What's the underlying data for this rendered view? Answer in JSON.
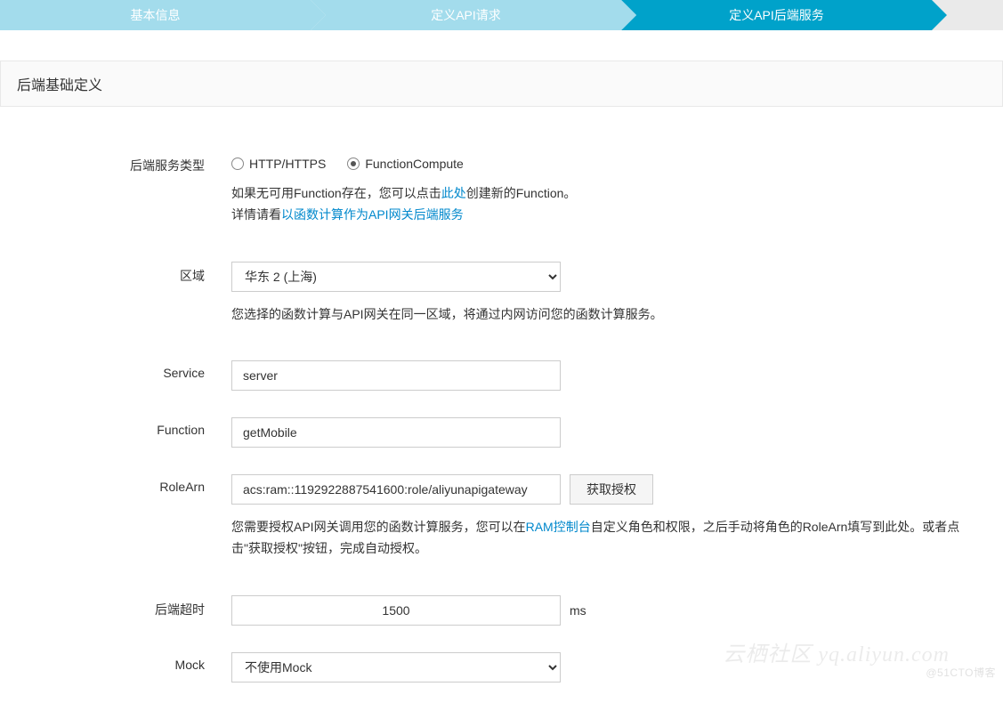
{
  "stepper": {
    "steps": [
      {
        "label": "基本信息",
        "state": "done"
      },
      {
        "label": "定义API请求",
        "state": "done"
      },
      {
        "label": "定义API后端服务",
        "state": "active"
      }
    ]
  },
  "section": {
    "title": "后端基础定义"
  },
  "form": {
    "backend_type": {
      "label": "后端服务类型",
      "options": {
        "http": "HTTP/HTTPS",
        "fc": "FunctionCompute"
      },
      "selected": "fc",
      "hint_prefix": "如果无可用Function存在，您可以点击",
      "hint_link1": "此处",
      "hint_mid": "创建新的Function。",
      "hint_prefix2": "详情请看",
      "hint_link2": "以函数计算作为API网关后端服务"
    },
    "region": {
      "label": "区域",
      "value": "华东 2 (上海)",
      "hint": "您选择的函数计算与API网关在同一区域，将通过内网访问您的函数计算服务。"
    },
    "service": {
      "label": "Service",
      "value": "server"
    },
    "function": {
      "label": "Function",
      "value": "getMobile"
    },
    "rolearn": {
      "label": "RoleArn",
      "value": "acs:ram::1192922887541600:role/aliyunapigateway",
      "button": "获取授权",
      "hint_prefix": "您需要授权API网关调用您的函数计算服务，您可以在",
      "hint_link": "RAM控制台",
      "hint_suffix": "自定义角色和权限，之后手动将角色的RoleArn填写到此处。或者点击\"获取授权\"按钮，完成自动授权。"
    },
    "timeout": {
      "label": "后端超时",
      "value": "1500",
      "unit": "ms"
    },
    "mock": {
      "label": "Mock",
      "value": "不使用Mock"
    }
  },
  "watermark": {
    "wm1": "云栖社区 yq.aliyun.com",
    "wm2": "@51CTO博客"
  }
}
